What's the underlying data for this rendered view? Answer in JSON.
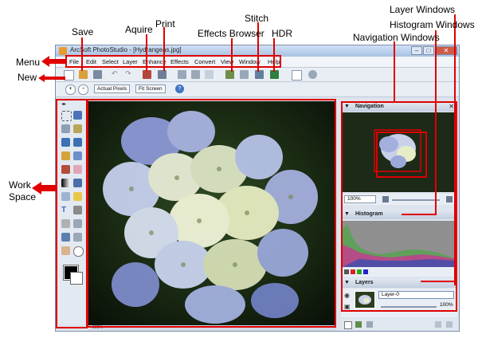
{
  "window": {
    "title": "ArcSoft PhotoStudio - [Hydrangeas.jpg]"
  },
  "menu": [
    "File",
    "Edit",
    "Select",
    "Layer",
    "Enhance",
    "Effects",
    "Convert",
    "View",
    "Window",
    "Help"
  ],
  "toolbar2": {
    "actual_pixels": "Actual Pixels",
    "fit_screen": "Fit Screen"
  },
  "panels": {
    "navigation": {
      "title": "Navigation",
      "zoom": "100%"
    },
    "histogram": {
      "title": "Histogram"
    },
    "layers": {
      "title": "Layers",
      "layer_name": "Layer-0",
      "opacity": "100%"
    }
  },
  "statusbar": {
    "zoom": "100%"
  },
  "callouts": {
    "menu": "Menu",
    "new": "New",
    "save": "Save",
    "aquire": "Aquire",
    "print": "Print",
    "stitch": "Stitch",
    "effects_browser": "Effects Browser",
    "hdr": "HDR",
    "layer_windows": "Layer Windows",
    "histogram_windows": "Histogram Windows",
    "navigation_windows": "Navigation Windows",
    "work": "Work",
    "space": "Space"
  },
  "colors": {
    "annotation_red": "#e00000",
    "panel_header": "#c3cfdf",
    "window_frame": "#7d8fa9"
  },
  "icons": [
    "app-icon",
    "new-icon",
    "open-icon",
    "save-icon",
    "undo-icon",
    "redo-icon",
    "acquire-icon",
    "print-icon",
    "stitch-icon",
    "effects-browser-icon",
    "hdr-icon",
    "zoom-in-icon",
    "zoom-out-icon",
    "help-icon"
  ]
}
